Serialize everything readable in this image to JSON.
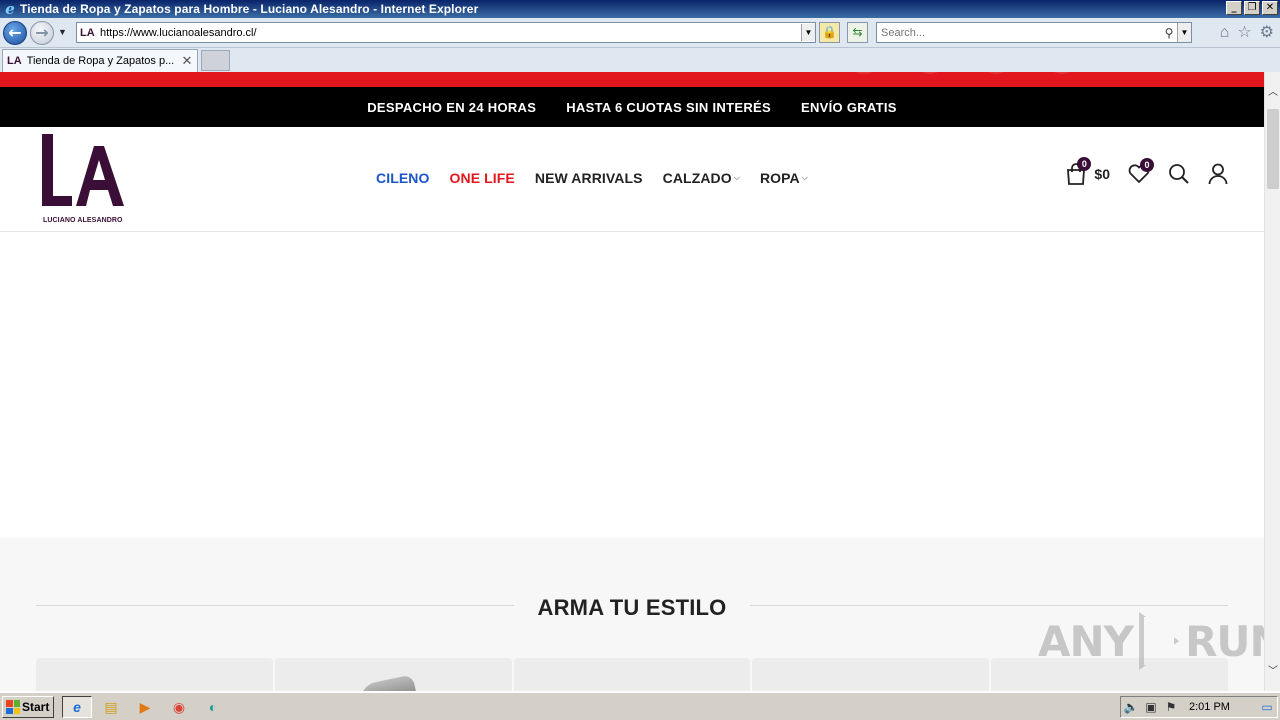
{
  "browser": {
    "window_title": "Tienda de Ropa y Zapatos para Hombre - Luciano Alesandro - Internet Explorer",
    "address": "https://www.lucianoalesandro.cl/",
    "search_placeholder": "Search...",
    "tab_title": "Tienda de Ropa y Zapatos p...",
    "favicon_text": "LA"
  },
  "promo": {
    "items": [
      "DESPACHO EN 24 HORAS",
      "HASTA 6 CUOTAS SIN INTERÉS",
      "ENVÍO GRATIS"
    ]
  },
  "header": {
    "logo_text": "LA",
    "logo_wordmark": "LUCIANO ALESANDRO",
    "menu": [
      {
        "label": "CILENO",
        "color": "#1a56c8"
      },
      {
        "label": "ONE LIFE",
        "color": "#e2171e"
      },
      {
        "label": "NEW ARRIVALS",
        "color": "#222222"
      },
      {
        "label": "CALZADO",
        "color": "#222222",
        "has_dropdown": true
      },
      {
        "label": "ROPA",
        "color": "#222222",
        "has_dropdown": true
      }
    ],
    "cart_count": "0",
    "cart_total": "$0",
    "wishlist_count": "0"
  },
  "section": {
    "title": "ARMA TU ESTILO"
  },
  "watermark": "ANY RUN",
  "taskbar": {
    "start_label": "Start",
    "clock": "2:01 PM"
  },
  "colors": {
    "brand": "#3a0e36",
    "topbar_red": "#e2171e",
    "promobar_black": "#000000"
  }
}
